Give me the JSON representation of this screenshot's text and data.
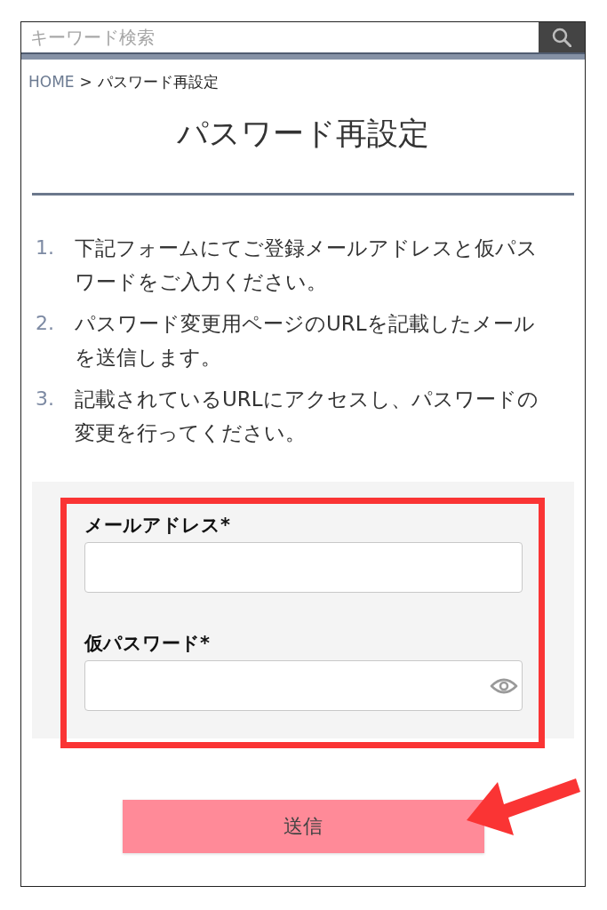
{
  "search": {
    "placeholder": "キーワード検索"
  },
  "breadcrumb": [
    {
      "label": "HOME",
      "kind": "link"
    },
    {
      "label": ">",
      "kind": "separator"
    },
    {
      "label": "パスワード再設定",
      "kind": "current"
    }
  ],
  "title": "パスワード再設定",
  "steps": [
    {
      "number": "1.",
      "text": "下記フォームにてご登録メールアドレスと仮パスワードをご入力ください。"
    },
    {
      "number": "2.",
      "text": "パスワード変更用ページのURLを記載したメールを送信します。"
    },
    {
      "number": "3.",
      "text": "記載されているURLにアクセスし、パスワードの変更を行ってください。"
    }
  ],
  "form": {
    "highlighted": true,
    "fields": [
      {
        "label": "メールアドレス*",
        "kind": "text"
      },
      {
        "label": "仮パスワード*",
        "kind": "password"
      }
    ]
  },
  "submit": {
    "label": "送信",
    "arrow_pointer": true
  }
}
